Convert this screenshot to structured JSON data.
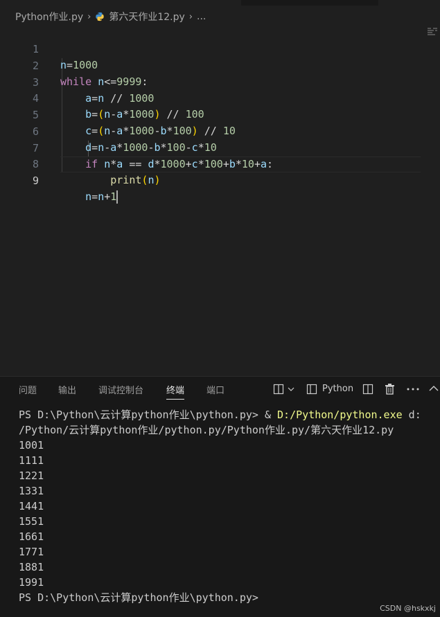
{
  "breadcrumb": {
    "folder": "Python作业.py",
    "file": "第六天作业12.py",
    "more": "..."
  },
  "editor": {
    "lines": [
      {
        "num": "1"
      },
      {
        "num": "2"
      },
      {
        "num": "3"
      },
      {
        "num": "4"
      },
      {
        "num": "5"
      },
      {
        "num": "6"
      },
      {
        "num": "7"
      },
      {
        "num": "8"
      },
      {
        "num": "9"
      }
    ]
  },
  "panel": {
    "tabs": [
      "问题",
      "输出",
      "调试控制台",
      "终端",
      "端口"
    ],
    "active_tab": "终端",
    "terminal_profile": "Python"
  },
  "terminal": {
    "prompt1": "PS D:\\Python\\云计算python作业\\python.py> ",
    "amp": "& ",
    "exe": "D:/Python/python.exe",
    "cmd_rest": " d:",
    "cmd_line2": "/Python/云计算python作业/python.py/Python作业.py/第六天作业12.py",
    "outputs": [
      "1001",
      "1111",
      "1221",
      "1331",
      "1441",
      "1551",
      "1661",
      "1771",
      "1881",
      "1991"
    ],
    "prompt2": "PS D:\\Python\\云计算python作业\\python.py>"
  },
  "watermark": "CSDN @hskxkj",
  "colors": {
    "keyword": "#c586c0",
    "variable": "#9cdcfe",
    "number": "#b5cea8",
    "function": "#dcdcaa",
    "exe_path": "#f1fa8c"
  }
}
